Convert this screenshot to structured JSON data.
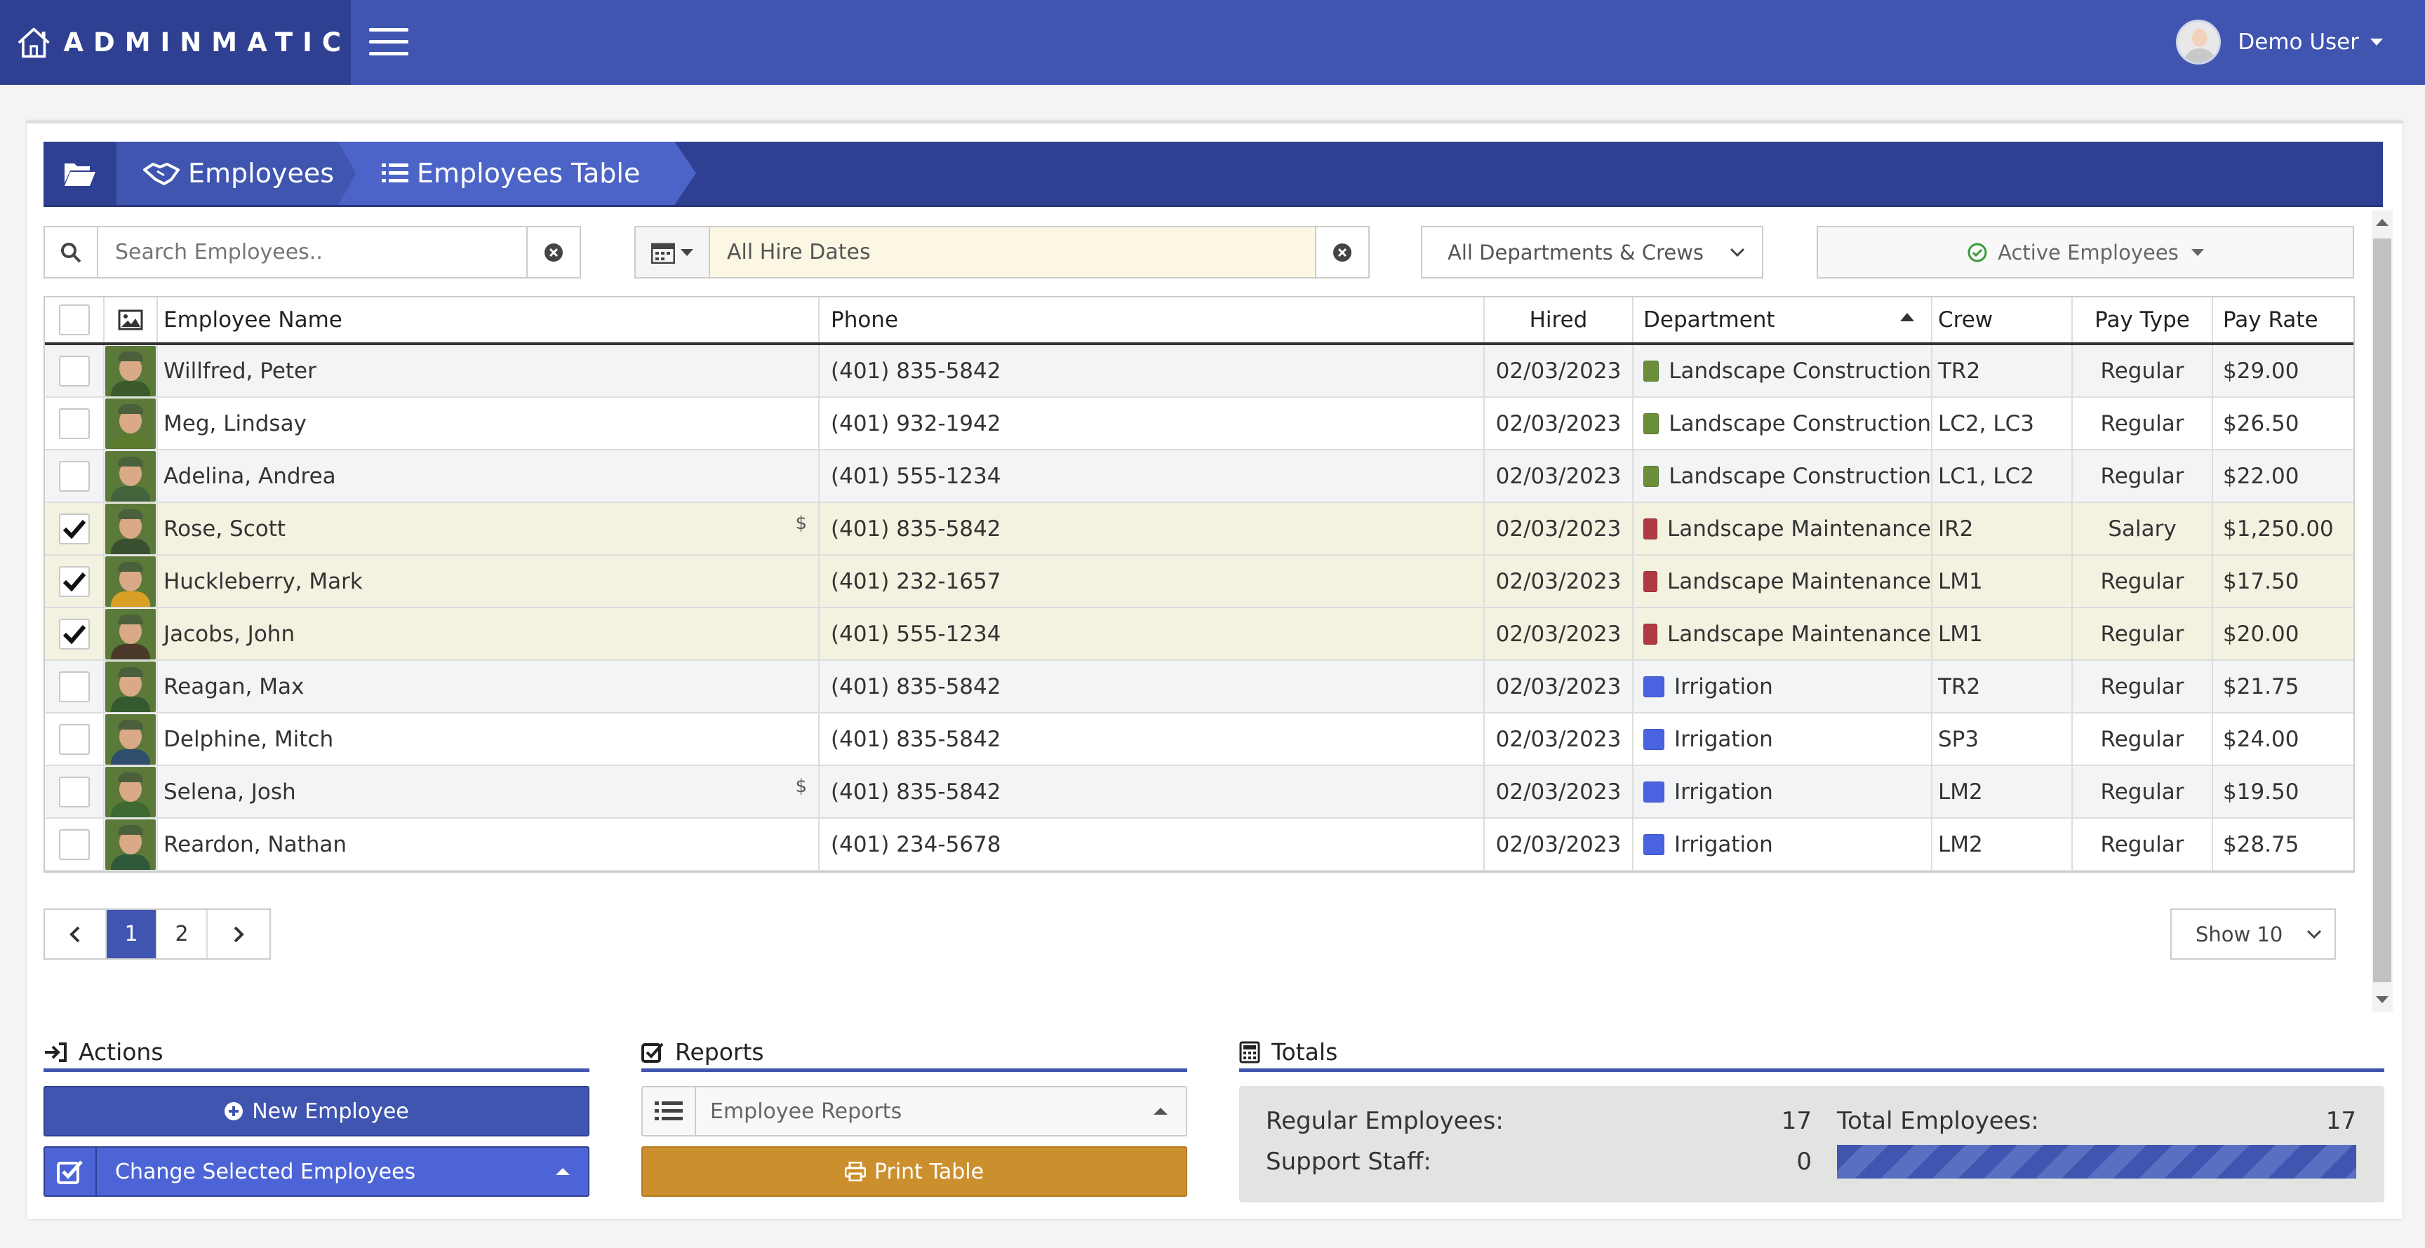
{
  "app": {
    "name": "ADMINMATIC",
    "user_name": "Demo User"
  },
  "breadcrumb": [
    {
      "label": "Employees",
      "icon": "handshake-icon"
    },
    {
      "label": "Employees Table",
      "icon": "list-icon"
    }
  ],
  "filters": {
    "search_placeholder": "Search Employees..",
    "hire_dates": "All Hire Dates",
    "departments": "All Departments & Crews",
    "status": "Active Employees"
  },
  "table": {
    "columns": [
      "Employee Name",
      "Phone",
      "Hired",
      "Department",
      "Crew",
      "Pay Type",
      "Pay Rate"
    ],
    "rows": [
      {
        "name": "Willfred, Peter",
        "phone": "(401) 835-5842",
        "hired": "02/03/2023",
        "department": "Landscape Construction",
        "dept_color": "#6b8e3a",
        "crew": "TR2",
        "pay_type": "Regular",
        "pay_rate": "$29.00",
        "checked": false,
        "dollar": false
      },
      {
        "name": "Meg, Lindsay",
        "phone": "(401) 932-1942",
        "hired": "02/03/2023",
        "department": "Landscape Construction",
        "dept_color": "#6b8e3a",
        "crew": "LC2, LC3",
        "pay_type": "Regular",
        "pay_rate": "$26.50",
        "checked": false,
        "dollar": false
      },
      {
        "name": "Adelina, Andrea",
        "phone": "(401) 555-1234",
        "hired": "02/03/2023",
        "department": "Landscape Construction",
        "dept_color": "#6b8e3a",
        "crew": "LC1, LC2",
        "pay_type": "Regular",
        "pay_rate": "$22.00",
        "checked": false,
        "dollar": false
      },
      {
        "name": "Rose, Scott",
        "phone": "(401) 835-5842",
        "hired": "02/03/2023",
        "department": "Landscape Maintenance",
        "dept_color": "#b03a44",
        "crew": "IR2",
        "pay_type": "Salary",
        "pay_rate": "$1,250.00",
        "checked": true,
        "dollar": true
      },
      {
        "name": "Huckleberry, Mark",
        "phone": "(401) 232-1657",
        "hired": "02/03/2023",
        "department": "Landscape Maintenance",
        "dept_color": "#b03a44",
        "crew": "LM1",
        "pay_type": "Regular",
        "pay_rate": "$17.50",
        "checked": true,
        "dollar": false
      },
      {
        "name": "Jacobs, John",
        "phone": "(401) 555-1234",
        "hired": "02/03/2023",
        "department": "Landscape Maintenance",
        "dept_color": "#b03a44",
        "crew": "LM1",
        "pay_type": "Regular",
        "pay_rate": "$20.00",
        "checked": true,
        "dollar": false
      },
      {
        "name": "Reagan, Max",
        "phone": "(401) 835-5842",
        "hired": "02/03/2023",
        "department": "Irrigation",
        "dept_color": "#4a63e0",
        "crew": "TR2",
        "pay_type": "Regular",
        "pay_rate": "$21.75",
        "checked": false,
        "dollar": false
      },
      {
        "name": "Delphine, Mitch",
        "phone": "(401) 835-5842",
        "hired": "02/03/2023",
        "department": "Irrigation",
        "dept_color": "#4a63e0",
        "crew": "SP3",
        "pay_type": "Regular",
        "pay_rate": "$24.00",
        "checked": false,
        "dollar": false
      },
      {
        "name": "Selena, Josh",
        "phone": "(401) 835-5842",
        "hired": "02/03/2023",
        "department": "Irrigation",
        "dept_color": "#4a63e0",
        "crew": "LM2",
        "pay_type": "Regular",
        "pay_rate": "$19.50",
        "checked": false,
        "dollar": true
      },
      {
        "name": "Reardon, Nathan",
        "phone": "(401) 234-5678",
        "hired": "02/03/2023",
        "department": "Irrigation",
        "dept_color": "#4a63e0",
        "crew": "LM2",
        "pay_type": "Regular",
        "pay_rate": "$28.75",
        "checked": false,
        "dollar": false
      }
    ]
  },
  "pagination": {
    "pages": [
      "1",
      "2"
    ],
    "current": "1",
    "show": "Show 10"
  },
  "actions": {
    "title": "Actions",
    "new_employee": "New Employee",
    "change_selected": "Change Selected Employees"
  },
  "reports": {
    "title": "Reports",
    "employee_reports": "Employee Reports",
    "print_table": "Print Table"
  },
  "totals": {
    "title": "Totals",
    "regular_label": "Regular Employees:",
    "regular_value": "17",
    "support_label": "Support Staff:",
    "support_value": "0",
    "total_label": "Total Employees:",
    "total_value": "17"
  },
  "colors": {
    "primary": "#3f55b0",
    "dark": "#2f4093",
    "accent": "#cc8f2e"
  }
}
